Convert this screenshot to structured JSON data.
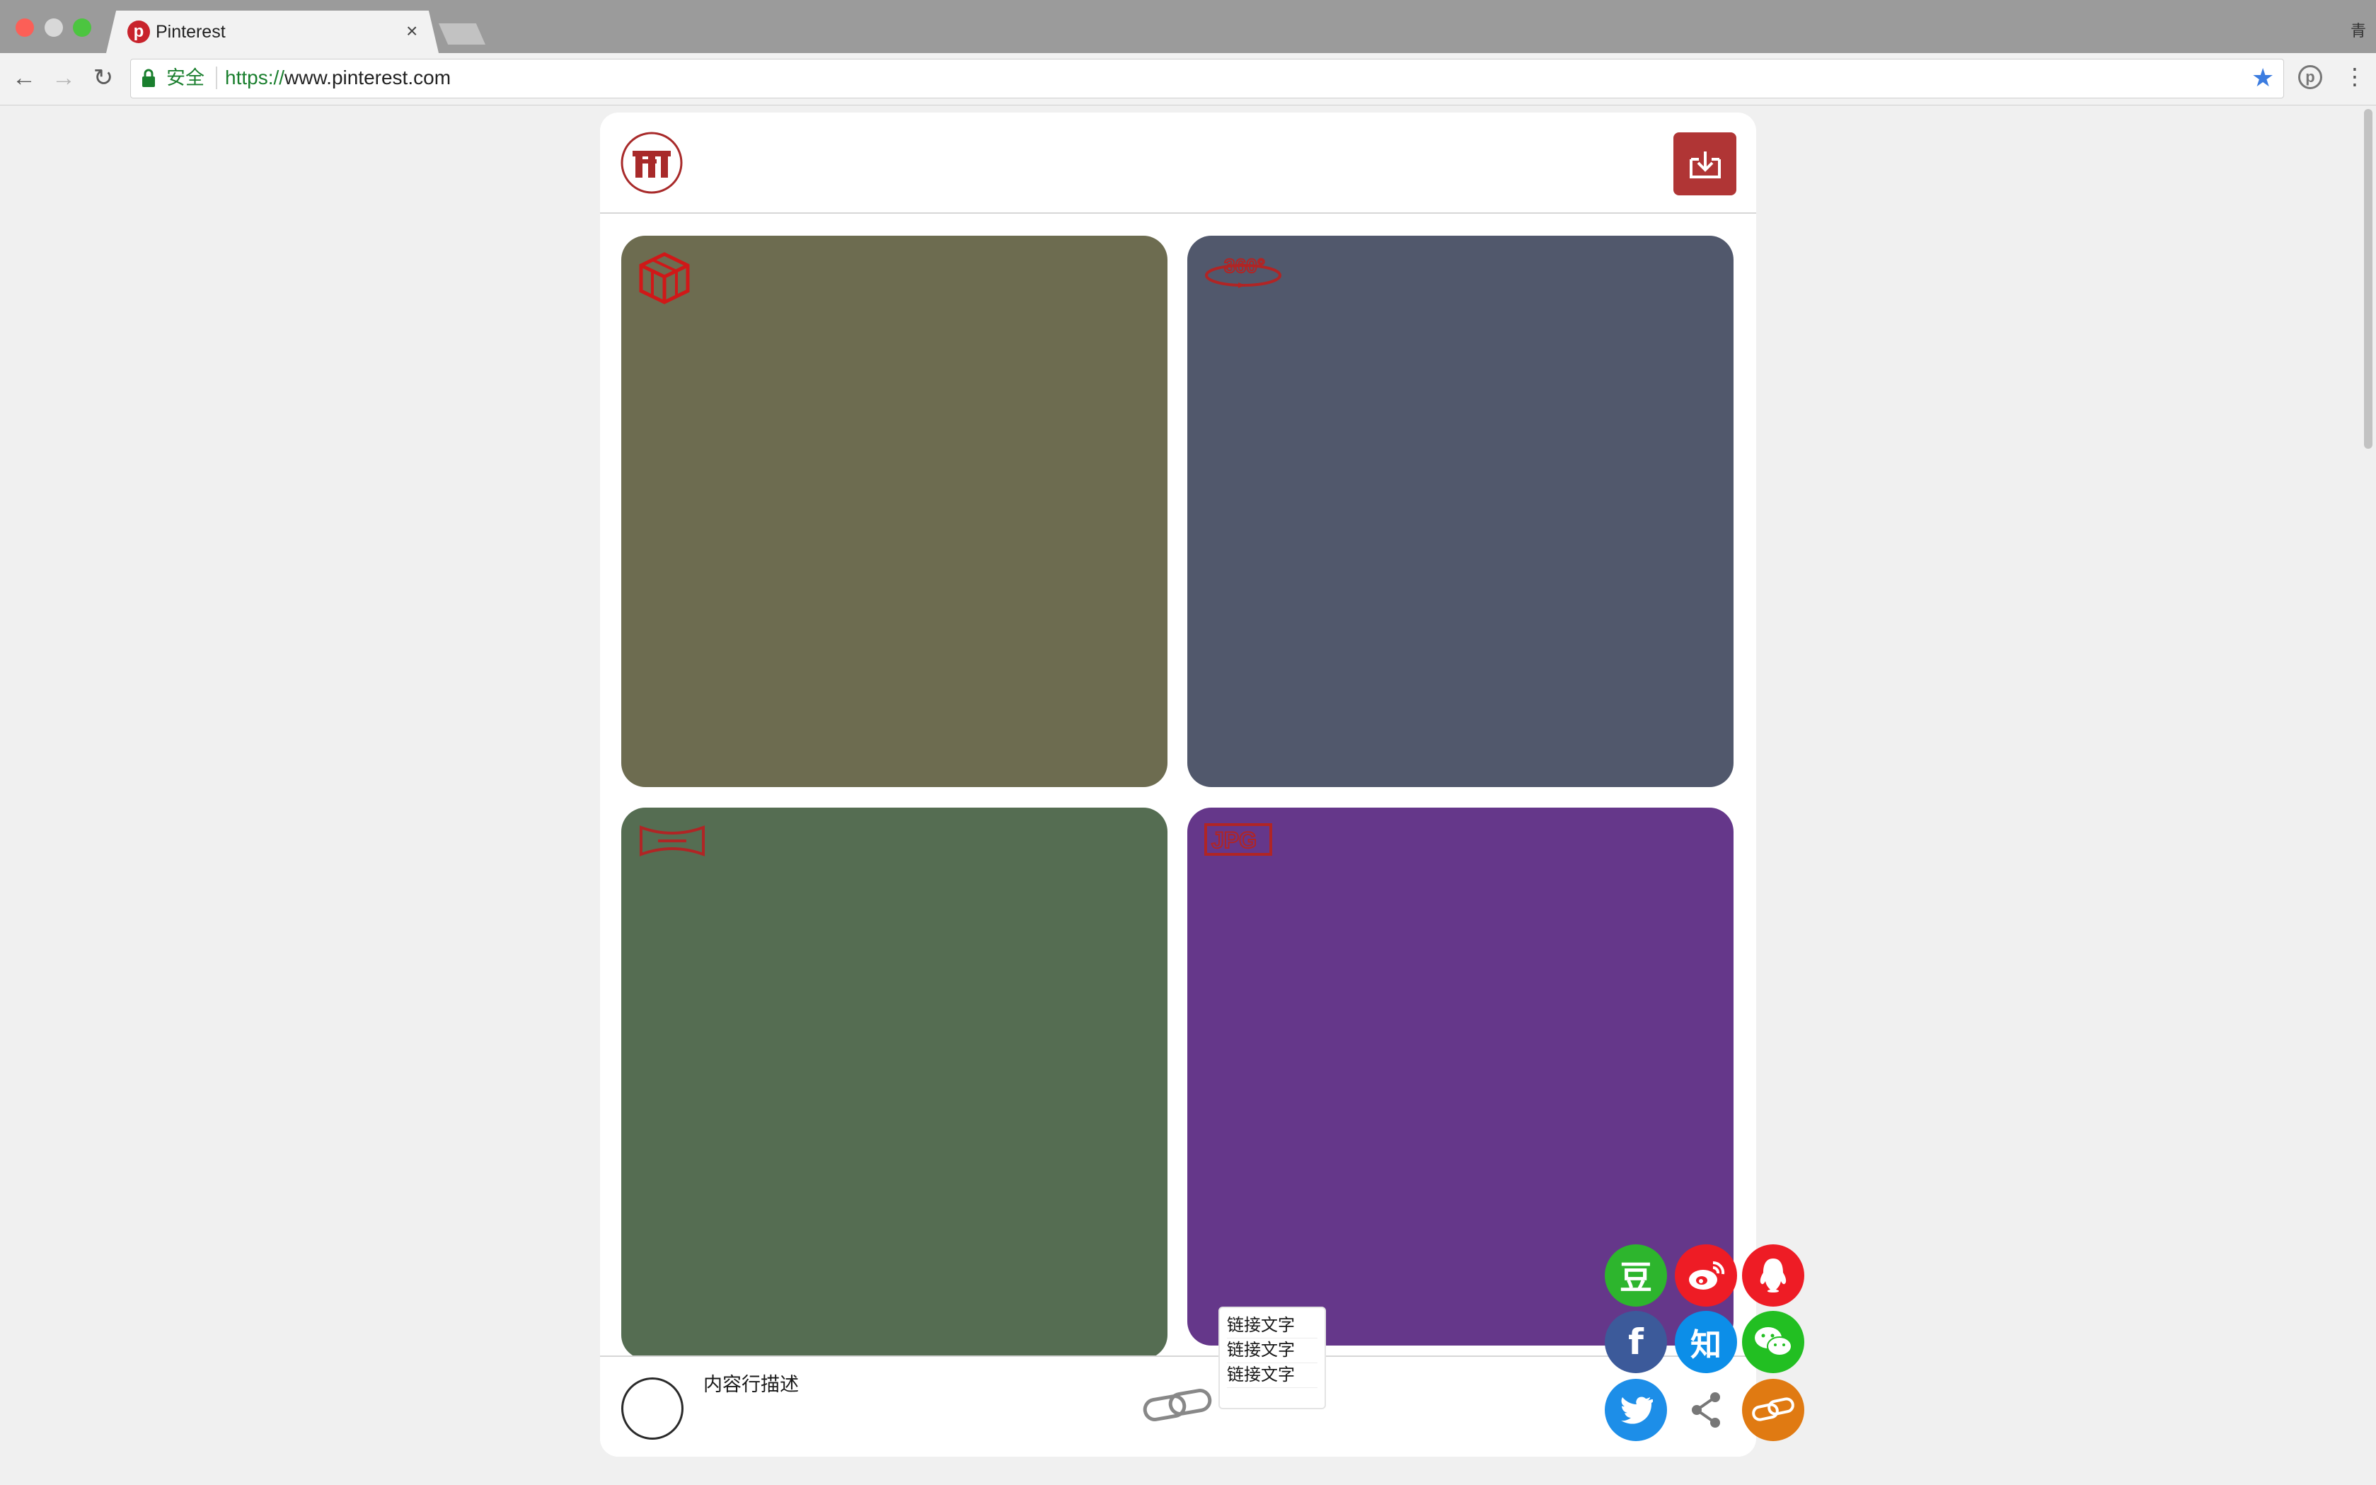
{
  "browser": {
    "tab_title": "Pinterest",
    "tab_close": "×",
    "profile_glyph": "青",
    "secure_label": "安全",
    "url_scheme": "https://",
    "url_host": "www.pinterest.com"
  },
  "card": {
    "description": "内容行描述",
    "link_texts": [
      "链接文字",
      "链接文字",
      "链接文字"
    ]
  },
  "share": {
    "douban": "豆",
    "zhihu": "知",
    "facebook": "f"
  },
  "colors": {
    "brand_red": "#b03535",
    "tile_1": "#6d6c50",
    "tile_2": "#51586c",
    "tile_3": "#556d52",
    "tile_4": "#65378a"
  },
  "icons": {
    "tile_1": "3d-box-icon",
    "tile_2": "360-view-icon",
    "tile_3": "panorama-icon",
    "tile_4": "jpg-icon"
  }
}
